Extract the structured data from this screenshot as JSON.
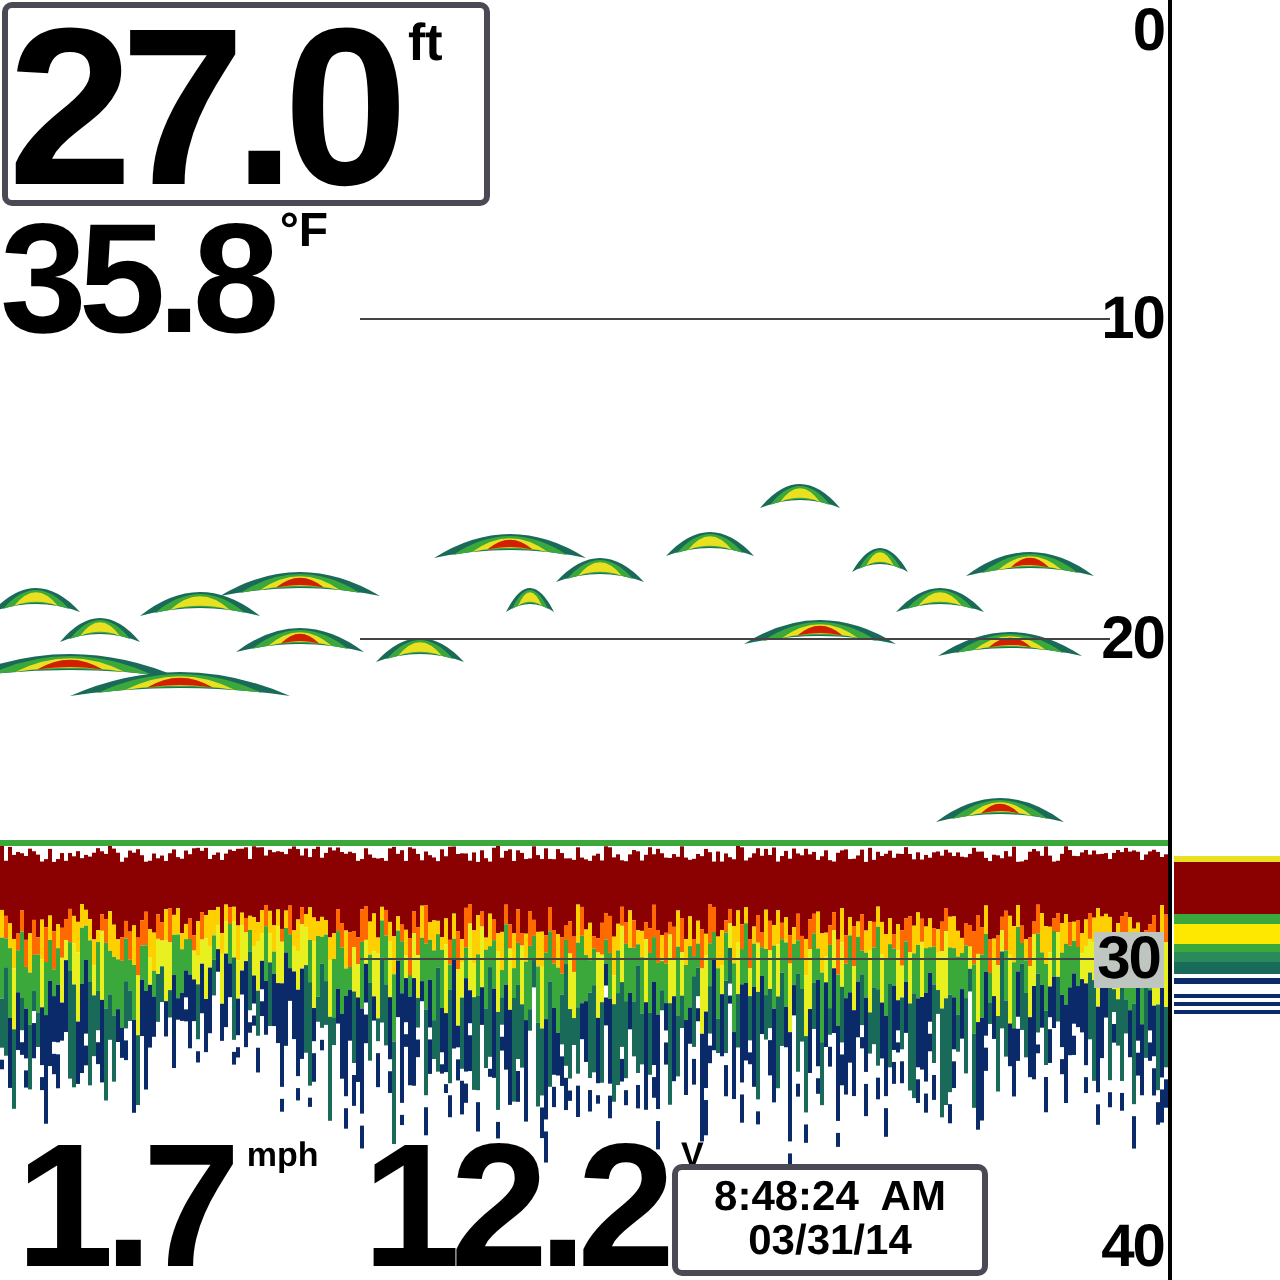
{
  "depth": {
    "value": "27.0",
    "unit": "ft"
  },
  "temperature": {
    "value": "35.8",
    "unit": "°F"
  },
  "speed": {
    "value": "1.7",
    "unit": "mph"
  },
  "voltage": {
    "value": "12.2",
    "unit": "V"
  },
  "clock": {
    "time": "8:48:24  AM",
    "date": "03/31/14"
  },
  "depth_scale": [
    "0",
    "10",
    "20",
    "30",
    "40"
  ]
}
